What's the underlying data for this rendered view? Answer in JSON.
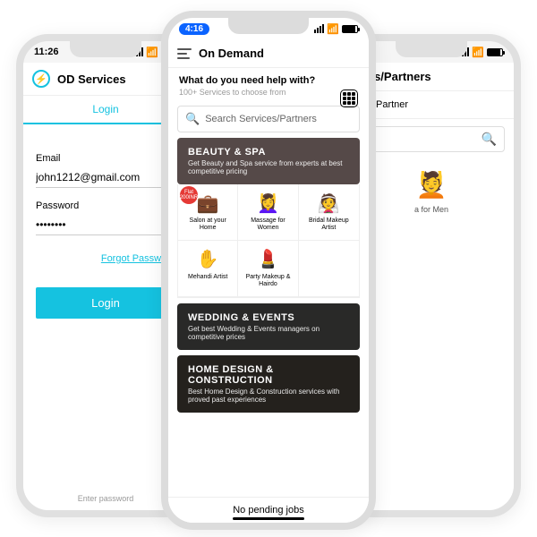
{
  "left": {
    "time": "11:26",
    "app_title": "OD Services",
    "tab_login": "Login",
    "email_label": "Email",
    "email_value": "john1212@gmail.com",
    "password_label": "Password",
    "password_value": "••••••••",
    "forgot": "Forgot Password",
    "login_btn": "Login",
    "hint": "Enter password"
  },
  "center": {
    "time": "4:16",
    "app_title": "On Demand",
    "question": "What do you need help with?",
    "subtitle": "100+ Services to choose from",
    "search_placeholder": "Search Services/Partners",
    "beauty": {
      "title": "BEAUTY & SPA",
      "desc": "Get Beauty and Spa service from experts at best competitive pricing"
    },
    "services": [
      {
        "name": "Salon at your Home",
        "badge": "Flat\n200INR"
      },
      {
        "name": "Massage\nfor Women"
      },
      {
        "name": "Bridal Makeup Artist"
      },
      {
        "name": "Mehandi Artist"
      },
      {
        "name": "Party Makeup\n& Hairdo"
      }
    ],
    "wedding": {
      "title": "WEDDING & EVENTS",
      "desc": "Get best Wedding & Events managers on competitive prices"
    },
    "homec": {
      "title": "HOME DESIGN & CONSTRUCTION",
      "desc": "Best Home Design & Construction services with proved past experiences"
    },
    "bottom": "No pending jobs"
  },
  "right": {
    "header": "ices/Partners",
    "tab": "Partner",
    "service": "a for Men"
  }
}
